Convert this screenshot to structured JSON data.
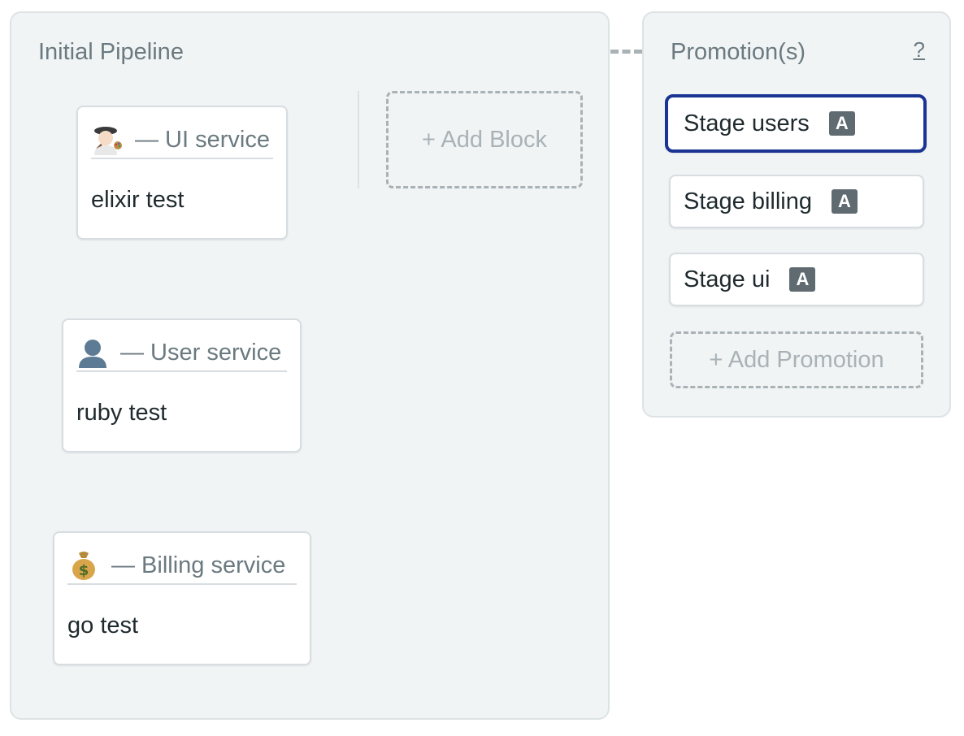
{
  "pipeline": {
    "title": "Initial Pipeline",
    "blocks": [
      {
        "emoji": "artist-icon",
        "name": "— UI service",
        "job": "elixir test"
      },
      {
        "emoji": "user-silhouette-icon",
        "name": "— User service",
        "job": "ruby test"
      },
      {
        "emoji": "money-bag-icon",
        "name": "— Billing service",
        "job": "go test"
      }
    ],
    "add_block_label": "+ Add Block"
  },
  "promotions": {
    "title": "Promotion(s)",
    "help_label": "?",
    "items": [
      {
        "label": "Stage users",
        "badge": "A",
        "selected": true
      },
      {
        "label": "Stage billing",
        "badge": "A",
        "selected": false
      },
      {
        "label": "Stage ui",
        "badge": "A",
        "selected": false
      }
    ],
    "add_promotion_label": "+ Add Promotion"
  },
  "colors": {
    "panel_bg": "#f1f4f5",
    "selected_border": "#1a3494",
    "badge_bg": "#5f6b70",
    "muted_text": "#6b7a80",
    "dashed": "#a9b2b6"
  }
}
